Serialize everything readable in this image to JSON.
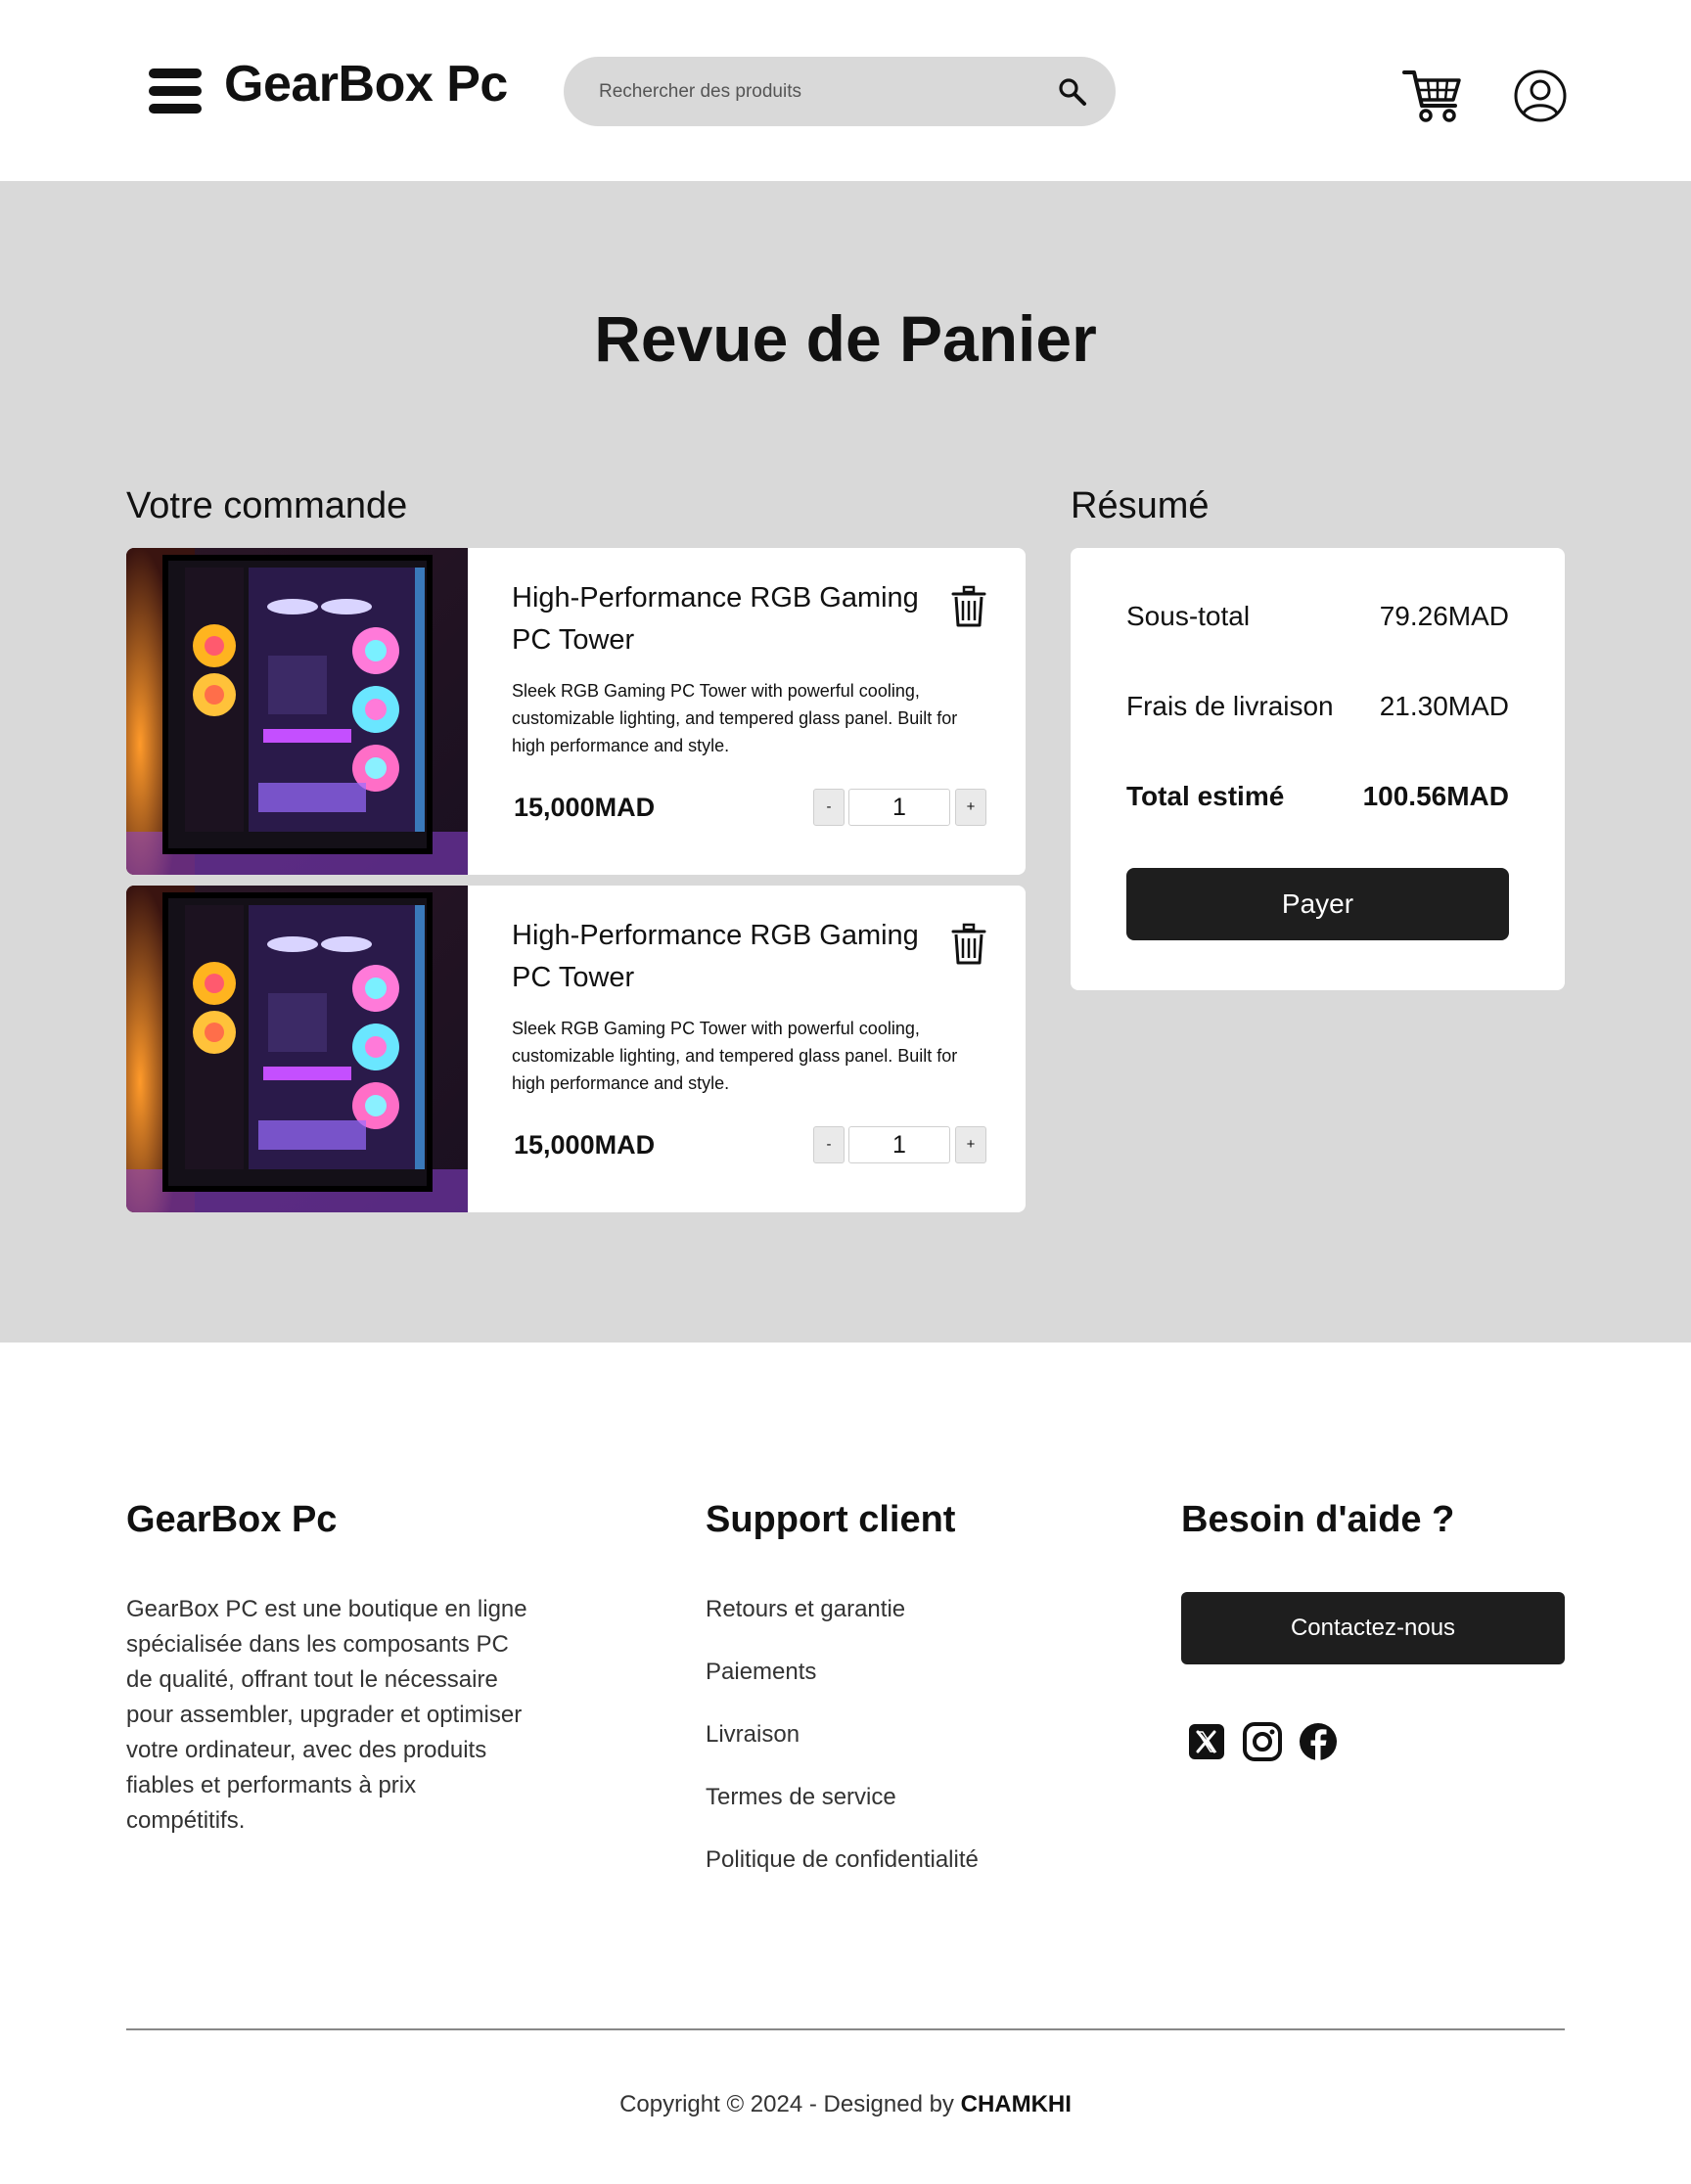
{
  "header": {
    "brand": "GearBox Pc",
    "search_placeholder": "Rechercher des produits"
  },
  "main": {
    "page_title": "Revue de Panier",
    "order_title": "Votre commande",
    "summary_title": "Résumé",
    "items": [
      {
        "name": "High-Performance RGB Gaming PC Tower",
        "description": "Sleek RGB Gaming PC Tower with powerful cooling, customizable lighting, and tempered glass panel. Built for high performance and style.",
        "price": "15,000MAD",
        "quantity": "1",
        "minus_label": "-",
        "plus_label": "+"
      },
      {
        "name": "High-Performance RGB Gaming PC Tower",
        "description": "Sleek RGB Gaming PC Tower with powerful cooling, customizable lighting, and tempered glass panel. Built for high performance and style.",
        "price": "15,000MAD",
        "quantity": "1",
        "minus_label": "-",
        "plus_label": "+"
      }
    ],
    "summary": {
      "subtotal_label": "Sous-total",
      "subtotal_value": "79.26MAD",
      "shipping_label": "Frais de livraison",
      "shipping_value": "21.30MAD",
      "total_label": "Total estimé",
      "total_value": "100.56MAD",
      "pay_label": "Payer"
    }
  },
  "footer": {
    "brand": "GearBox Pc",
    "about": "GearBox PC est une boutique en ligne spécialisée dans les composants PC de qualité, offrant tout le nécessaire pour assembler, upgrader et optimiser votre ordinateur, avec des produits fiables et performants à prix compétitifs.",
    "support_title": "Support client",
    "support_links": [
      "Retours et garantie",
      "Paiements",
      "Livraison",
      "Termes de service",
      "Politique de confidentialité"
    ],
    "help_title": "Besoin d'aide ?",
    "contact_label": "Contactez-nous",
    "socials": [
      "x-icon",
      "instagram-icon",
      "facebook-icon"
    ],
    "copyright_prefix": "Copyright © 2024 - Designed by ",
    "copyright_author": "CHAMKHI"
  },
  "colors": {
    "band": "#d9d9d9",
    "button": "#1e1e1e",
    "card": "#ffffff"
  }
}
